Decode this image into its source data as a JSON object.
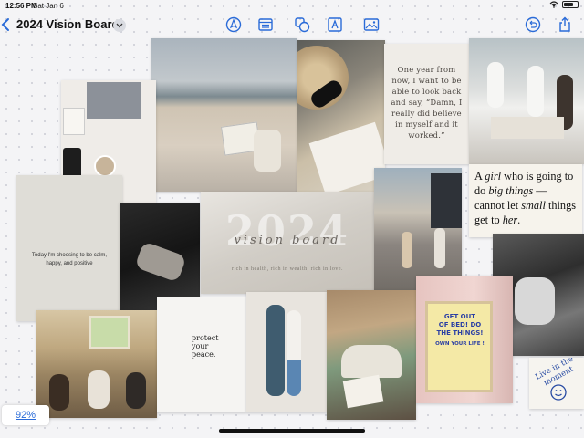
{
  "status_bar": {
    "time": "12:56 PM",
    "date": "Sat Jan 6"
  },
  "header": {
    "title": "2024 Vision Board"
  },
  "toolbar": {
    "icons": [
      "pen-tool-icon",
      "text-box-icon",
      "shapes-icon",
      "text-tool-icon",
      "image-icon",
      "undo-icon",
      "share-icon"
    ]
  },
  "board": {
    "quote_future": "One year from now, I want to be able to look back and say, “Damn, I really did believe in myself and it worked.”",
    "quote_big": {
      "part1": "A ",
      "part2": "girl",
      "part3": " who is going to do ",
      "part4": "big things",
      "part5": " — cannot let ",
      "part6": "small",
      "part7": " things get to ",
      "part8": "her",
      "part9": "."
    },
    "calm_text": "Today I'm choosing to be calm, happy, and positive",
    "vision": {
      "year": "2024",
      "label": "vision board",
      "subtitle": "rich in health, rich in wealth, rich in love."
    },
    "peace_lines": [
      "protect",
      "your",
      "peace."
    ],
    "poster_lines": [
      "GET OUT",
      "OF BED! DO",
      "THE THINGS!",
      "OWN YOUR LIFE !"
    ],
    "moment_text": "Live in the moment"
  },
  "zoom": "92%"
}
